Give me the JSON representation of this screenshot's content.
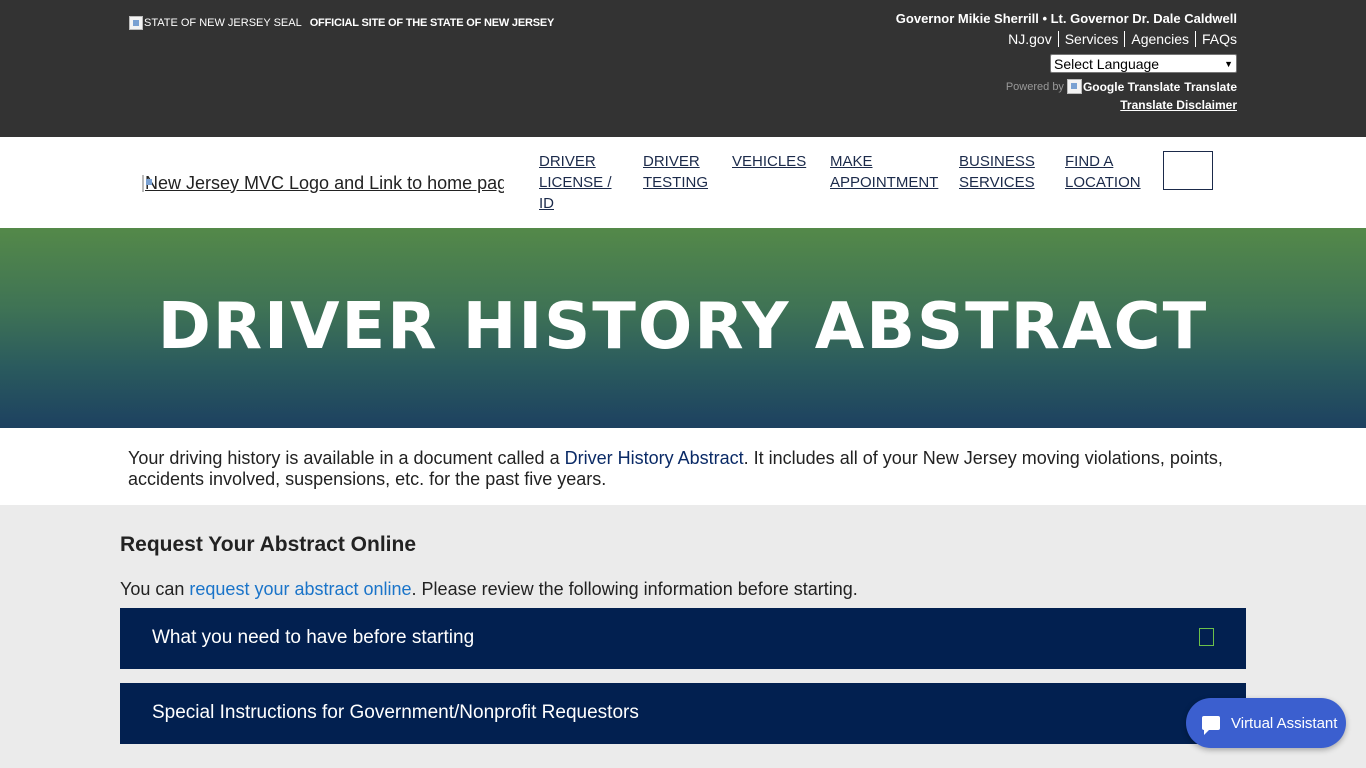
{
  "topbar": {
    "seal_alt": "STATE OF NEW JERSEY SEAL",
    "official_text": "OFFICIAL SITE OF THE STATE OF NEW JERSEY",
    "governor_line": "Governor Mikie Sherrill • Lt. Governor Dr. Dale Caldwell",
    "links": [
      "NJ.gov",
      "Services",
      "Agencies",
      "FAQs"
    ],
    "language_select": "Select Language",
    "powered_by": "Powered by",
    "google_translate_alt": "Google Translate",
    "translate_word": "Translate",
    "disclaimer": "Translate Disclaimer"
  },
  "nav": {
    "logo_alt": "New Jersey MVC Logo and Link to home page",
    "items": [
      {
        "label": "DRIVER LICENSE / ID"
      },
      {
        "label": "DRIVER TESTING"
      },
      {
        "label": "VEHICLES"
      },
      {
        "label": "MAKE APPOINTMENT"
      },
      {
        "label": "BUSINESS SERVICES"
      },
      {
        "label": "FIND A LOCATION"
      }
    ]
  },
  "hero": {
    "title": "DRIVER HISTORY ABSTRACT"
  },
  "intro": {
    "text_before": "Your driving history is available in a document called a ",
    "emphasis": "Driver History Abstract",
    "text_after": ". It includes all of your New Jersey moving violations, points, accidents involved, suspensions, etc. for the past five years."
  },
  "main": {
    "section_title": "Request Your Abstract Online",
    "lead_before": "You can ",
    "lead_link": "request your abstract online",
    "lead_after": ". Please review the following information before starting.",
    "accordions": [
      {
        "label": "What you need to have before starting"
      },
      {
        "label": "Special Instructions for Government/Nonprofit Requestors"
      }
    ]
  },
  "virtual_assistant": {
    "label": "Virtual Assistant"
  },
  "colors": {
    "topbar": "#333333",
    "accordion": "#022050",
    "link": "#1a74c9",
    "assistant": "#3b5fcf",
    "toggle_border": "#6cc04a"
  }
}
